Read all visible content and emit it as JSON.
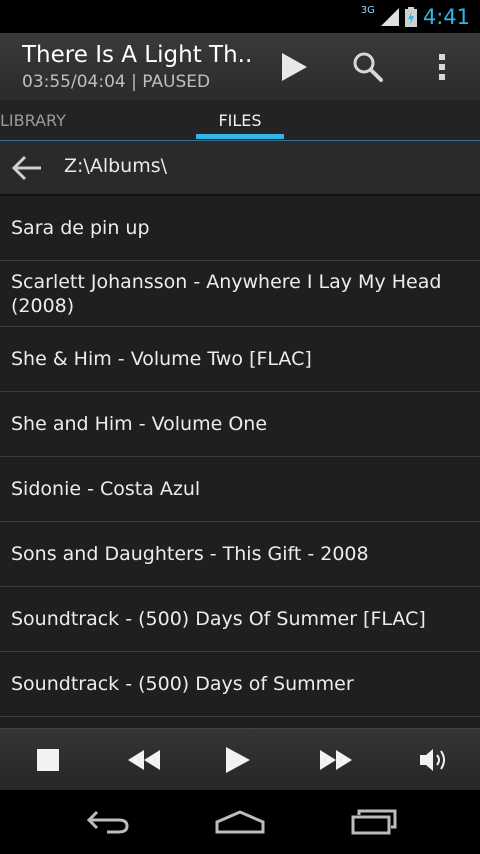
{
  "status_bar": {
    "network": "3G",
    "time": "4:41",
    "accent": "#33b5e5"
  },
  "now_playing": {
    "title": "There Is A Light Th...",
    "status": "03:55/04:04 | PAUSED"
  },
  "tabs": [
    {
      "label": "LIBRARY",
      "selected": false
    },
    {
      "label": "FILES",
      "selected": true
    }
  ],
  "path": "Z:\\Albums\\",
  "files": [
    "Sara de pin up",
    "Scarlett Johansson - Anywhere I Lay My Head (2008)",
    "She & Him - Volume Two [FLAC]",
    "She and Him - Volume One",
    "Sidonie - Costa Azul",
    "Sons and Daughters - This Gift - 2008",
    "Soundtrack - (500) Days Of Summer [FLAC]",
    "Soundtrack - (500) Days of Summer"
  ],
  "icons": {
    "header": [
      "play-icon",
      "search-icon",
      "overflow-menu-icon"
    ],
    "controls": [
      "stop-icon",
      "rewind-icon",
      "play-icon",
      "fast-forward-icon",
      "volume-icon"
    ],
    "navigation": [
      "back-icon",
      "home-icon",
      "recent-apps-icon"
    ]
  }
}
